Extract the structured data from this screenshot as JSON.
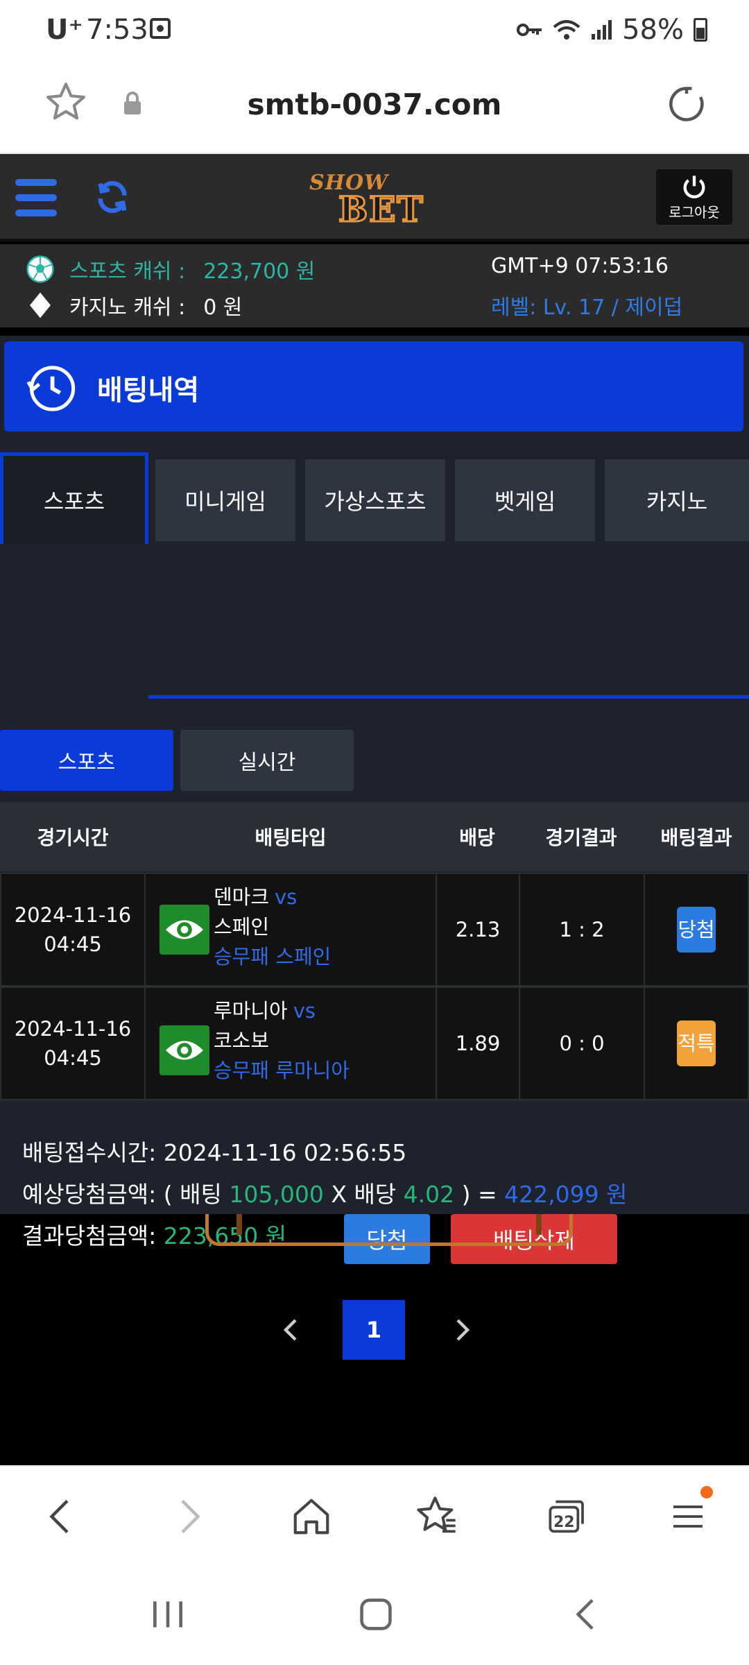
{
  "status_bar": {
    "carrier": "U⁺",
    "time": "7:53",
    "battery": "58%"
  },
  "browser": {
    "url": "smtb-0037.com",
    "tab_count": "22"
  },
  "site": {
    "logo_top": "SHOW",
    "logo_main": "BET",
    "logout_label": "로그아웃",
    "sports_cash_label": "스포츠 캐쉬 :",
    "sports_cash_value": "223,700 원",
    "casino_cash_label": "카지노 캐쉬 :",
    "casino_cash_value": "0 원",
    "clock": "GMT+9 07:53:16",
    "level": "레벨: Lv. 17 / 제이덥"
  },
  "page_title": "배팅내역",
  "tabs": [
    {
      "label": "스포츠",
      "active": true
    },
    {
      "label": "미니게임",
      "active": false
    },
    {
      "label": "가상스포츠",
      "active": false
    },
    {
      "label": "벳게임",
      "active": false
    },
    {
      "label": "카지노",
      "active": false
    }
  ],
  "subtabs": [
    {
      "label": "스포츠",
      "active": true
    },
    {
      "label": "실시간",
      "active": false
    }
  ],
  "table": {
    "headers": [
      "경기시간",
      "배팅타입",
      "배당",
      "경기결과",
      "배팅결과"
    ],
    "rows": [
      {
        "date": "2024-11-16",
        "time": "04:45",
        "home": "덴마크",
        "vs": "vs",
        "away": "스페인",
        "pick": "승무패 스페인",
        "odds": "2.13",
        "score": "1 : 2",
        "result": "당첨",
        "result_color": "#2b7be0"
      },
      {
        "date": "2024-11-16",
        "time": "04:45",
        "home": "루마니아",
        "vs": "vs",
        "away": "코소보",
        "pick": "승무패 루마니아",
        "odds": "1.89",
        "score": "0 : 0",
        "result": "적특",
        "result_color": "#f2a23a"
      }
    ]
  },
  "summary": {
    "received_label": "배팅접수시간:",
    "received_value": "2024-11-16 02:56:55",
    "expected_label": "예상당첨금액:",
    "expected_open": "( 배팅",
    "bet_amount": "105,000",
    "times": "X 배당",
    "total_odds": "4.02",
    "expected_close": ") =",
    "expected_amount": "422,099 원",
    "result_label": "결과당첨금액:",
    "result_amount": "223,650 원",
    "win_button": "당첨",
    "delete_button": "배팅삭제"
  },
  "pagination": {
    "current_page": "1"
  },
  "colors": {
    "primary_blue": "#0a3ad8",
    "teal": "#2cb6a6",
    "green": "#27b77b",
    "link_blue": "#2f6be6",
    "win_blue": "#2b7be0",
    "delete_red": "#dc3535",
    "void_orange": "#f2a23a"
  }
}
